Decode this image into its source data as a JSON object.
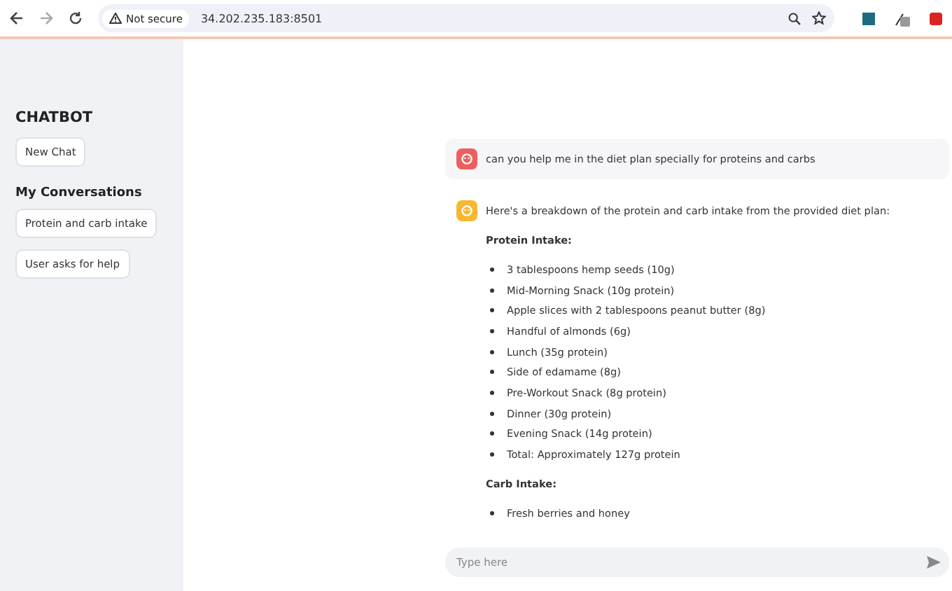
{
  "browser": {
    "security": "Not secure",
    "url": "34.202.235.183:8501"
  },
  "sidebar": {
    "title": "CHATBOT",
    "new_chat": "New Chat",
    "section": "My Conversations",
    "conversations": [
      {
        "label": "Protein and carb intake"
      },
      {
        "label": "User asks for help"
      }
    ]
  },
  "messages": [
    {
      "kind": "user",
      "text": "can you help me in the diet plan specially for proteins and carbs"
    },
    {
      "kind": "assistant",
      "blocks": [
        {
          "kind": "paragraph",
          "text": "Here's a breakdown of the protein and carb intake from the provided diet plan:"
        },
        {
          "kind": "heading",
          "text": "Protein Intake:"
        },
        {
          "kind": "list",
          "items": [
            "3 tablespoons hemp seeds (10g)",
            "Mid-Morning Snack (10g protein)",
            "Apple slices with 2 tablespoons peanut butter (8g)",
            "Handful of almonds (6g)",
            "Lunch (35g protein)",
            "Side of edamame (8g)",
            "Pre-Workout Snack (8g protein)",
            "Dinner (30g protein)",
            "Evening Snack (14g protein)",
            "Total: Approximately 127g protein"
          ]
        },
        {
          "kind": "heading",
          "text": "Carb Intake:"
        },
        {
          "kind": "list",
          "items": [
            "Fresh berries and honey"
          ]
        }
      ]
    }
  ],
  "chat_input": {
    "placeholder": "Type here"
  }
}
